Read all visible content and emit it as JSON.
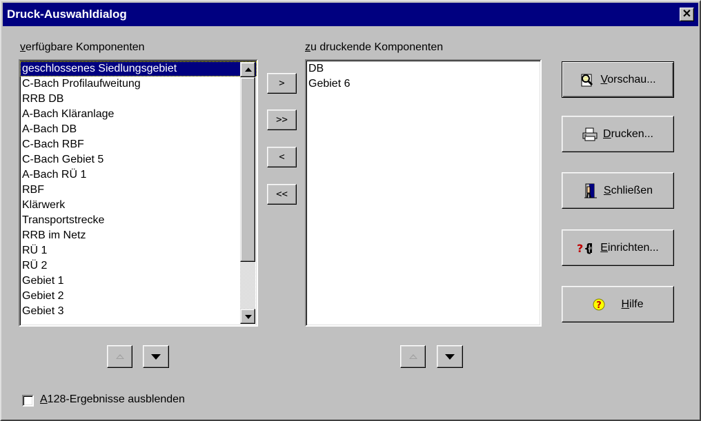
{
  "window": {
    "title": "Druck-Auswahldialog",
    "close_glyph": "✕"
  },
  "available": {
    "label_first": "v",
    "label_rest": "erfügbare Komponenten",
    "items": [
      "geschlossenes Siedlungsgebiet",
      "C-Bach Profilaufweitung",
      "RRB DB",
      "A-Bach Kläranlage",
      "A-Bach DB",
      "C-Bach RBF",
      "C-Bach Gebiet 5",
      "A-Bach RÜ 1",
      "RBF",
      "Klärwerk",
      "Transportstrecke",
      "RRB im Netz",
      "RÜ 1",
      "RÜ 2",
      "Gebiet 1",
      "Gebiet 2",
      "Gebiet 3"
    ],
    "selected_index": 0
  },
  "to_print": {
    "label_first": "z",
    "label_rest": "u druckende Komponenten",
    "items": [
      "DB",
      "Gebiet 6"
    ]
  },
  "transfer_buttons": {
    "add": ">",
    "add_all": ">>",
    "remove": "<",
    "remove_all": "<<"
  },
  "action_buttons": {
    "preview": {
      "mnemonic": "V",
      "rest": "orschau...",
      "icon": "preview-icon"
    },
    "print": {
      "mnemonic": "D",
      "rest": "rucken...",
      "icon": "printer-icon"
    },
    "close": {
      "mnemonic": "S",
      "rest": "chließen",
      "icon": "door-exit-icon"
    },
    "setup": {
      "mnemonic": "E",
      "rest": "inrichten...",
      "icon": "setup-icon"
    },
    "help": {
      "mnemonic": "H",
      "rest": "ilfe",
      "icon": "help-icon"
    }
  },
  "checkbox": {
    "mnemonic": "A",
    "rest": "128-Ergebnisse ausblenden",
    "checked": false
  }
}
